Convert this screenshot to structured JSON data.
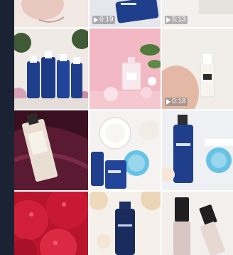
{
  "feed": {
    "tiles": [
      {
        "id": "hand-skin",
        "video": false
      },
      {
        "id": "blue-bottle-top",
        "video": true,
        "duration": "0:19"
      },
      {
        "id": "pale-top",
        "video": true,
        "duration": "5:13"
      },
      {
        "id": "blue-bottles-flowers",
        "video": false
      },
      {
        "id": "pink-perfume",
        "video": false
      },
      {
        "id": "hand-serum",
        "video": true,
        "duration": "0:18"
      },
      {
        "id": "amber-bottle-silk",
        "video": false
      },
      {
        "id": "cream-jars",
        "video": false
      },
      {
        "id": "blue-bottle-jar",
        "video": false
      },
      {
        "id": "raspberries",
        "video": false
      },
      {
        "id": "dark-bottle-blossom",
        "video": false
      },
      {
        "id": "lip-gloss",
        "video": false
      }
    ]
  },
  "colors": {
    "sidebar": "#1b2233",
    "product_blue": "#1f3f8c",
    "badge_bg": "rgba(120,120,120,0.55)"
  }
}
